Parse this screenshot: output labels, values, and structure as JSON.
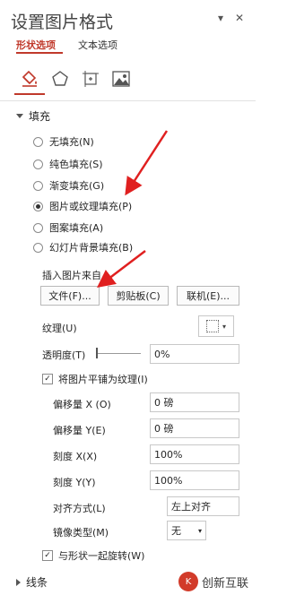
{
  "panel": {
    "title": "设置图片格式",
    "pin_glyph": "▾",
    "close_glyph": "✕",
    "tabs": {
      "shape": "形状选项",
      "text": "文本选项"
    }
  },
  "icons": [
    "fill-line-icon",
    "effects-pentagon-icon",
    "size-properties-icon",
    "picture-icon"
  ],
  "fill": {
    "header": "填充",
    "options": [
      {
        "label": "无填充(N)",
        "selected": false
      },
      {
        "label": "纯色填充(S)",
        "selected": false
      },
      {
        "label": "渐变填充(G)",
        "selected": false
      },
      {
        "label": "图片或纹理填充(P)",
        "selected": true
      },
      {
        "label": "图案填充(A)",
        "selected": false
      },
      {
        "label": "幻灯片背景填充(B)",
        "selected": false
      }
    ],
    "insert_from": "插入图片来自",
    "buttons": {
      "file": "文件(F)...",
      "clipboard": "剪贴板(C)",
      "online": "联机(E)..."
    },
    "texture_label": "纹理(U)",
    "transparency_label": "透明度(T)",
    "transparency_value": "0%",
    "tile_checkbox": "将图片平铺为纹理(I)",
    "tile_checked": true,
    "offset_x_label": "偏移量 X (O)",
    "offset_x_value": "0 磅",
    "offset_y_label": "偏移量 Y(E)",
    "offset_y_value": "0 磅",
    "scale_x_label": "刻度 X(X)",
    "scale_x_value": "100%",
    "scale_y_label": "刻度 Y(Y)",
    "scale_y_value": "100%",
    "align_label": "对齐方式(L)",
    "align_value": "左上对齐",
    "mirror_label": "镜像类型(M)",
    "mirror_value": "无",
    "rotate_checkbox": "与形状一起旋转(W)",
    "rotate_checked": true
  },
  "line": {
    "header": "线条"
  },
  "watermark": {
    "text": "创新互联",
    "logo": "K"
  },
  "colors": {
    "accent": "#c0392b",
    "arrow": "#e02020"
  }
}
